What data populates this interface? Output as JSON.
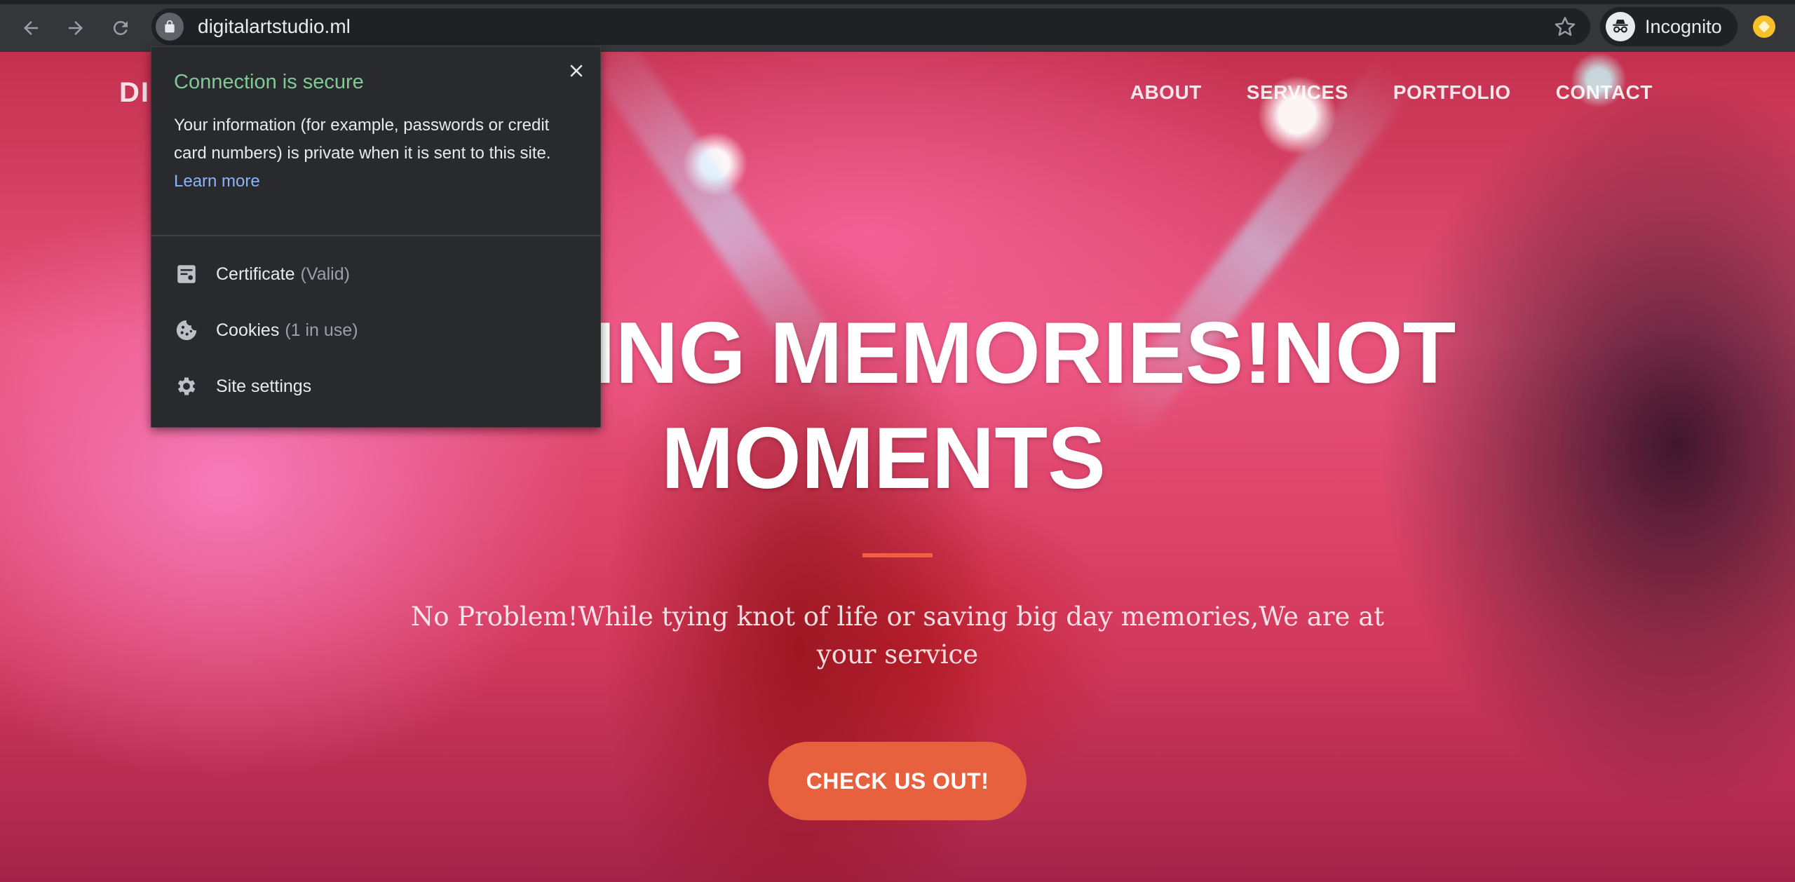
{
  "browser": {
    "url": "digitalartstudio.ml",
    "profile_label": "Incognito"
  },
  "site": {
    "brand": "DI",
    "nav": [
      "ABOUT",
      "SERVICES",
      "PORTFOLIO",
      "CONTACT"
    ],
    "hero_title_line1": "RING MEMORIES!NOT",
    "hero_title_line2": "MOMENTS",
    "hero_subtitle": "No Problem!While tying knot of life or saving big day  memories,We are at your service",
    "cta_label": "CHECK US OUT!",
    "accent_color": "#f05f40"
  },
  "security_popup": {
    "title": "Connection is secure",
    "description": "Your information (for example, passwords or credit card numbers) is private when it is sent to this site.",
    "learn_more": "Learn more",
    "certificate_label": "Certificate",
    "certificate_status": "(Valid)",
    "cookies_label": "Cookies",
    "cookies_status": "(1 in use)",
    "site_settings_label": "Site settings",
    "title_color": "#81c995",
    "link_color": "#8ab4f8"
  },
  "icons": [
    "back-arrow-icon",
    "forward-arrow-icon",
    "reload-icon",
    "lock-icon",
    "star-icon",
    "incognito-icon",
    "close-icon",
    "certificate-icon",
    "cookie-icon",
    "gear-icon"
  ]
}
